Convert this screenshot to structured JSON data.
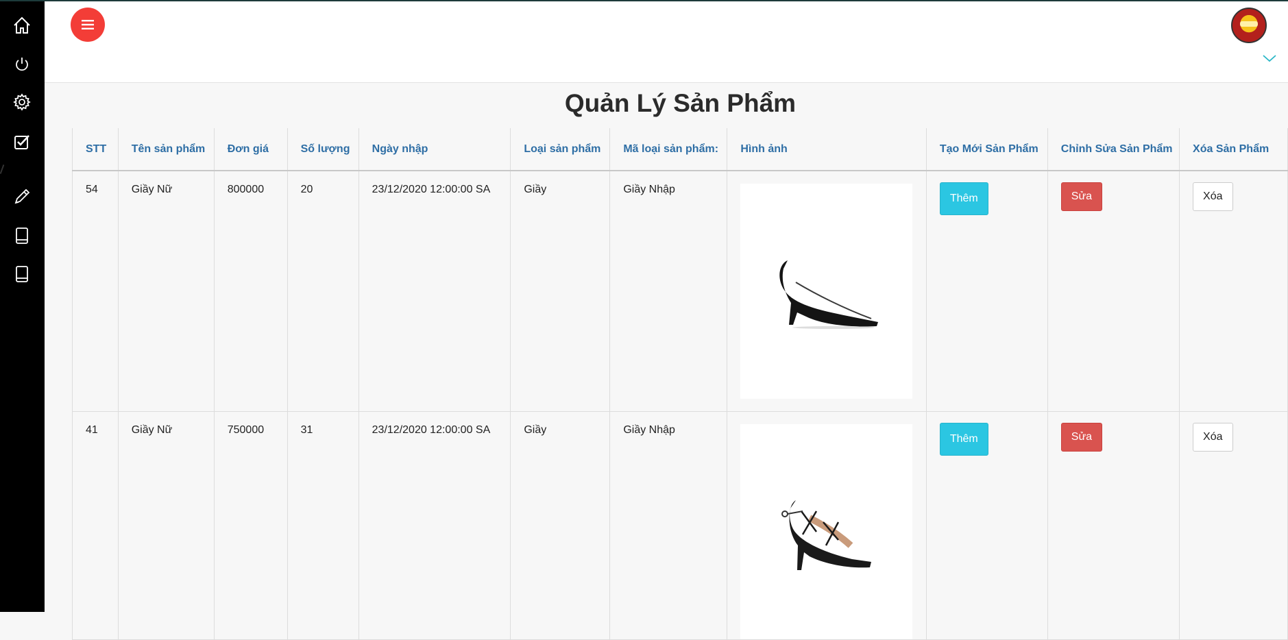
{
  "page": {
    "title": "Quản Lý Sản Phẩm"
  },
  "sidebar": {
    "items": [
      {
        "icon": "home-icon"
      },
      {
        "icon": "power-icon"
      },
      {
        "icon": "gear-icon"
      },
      {
        "icon": "checkbox-icon"
      },
      {
        "icon": "pencil-icon"
      },
      {
        "icon": "book-icon"
      },
      {
        "icon": "book-icon"
      }
    ]
  },
  "colors": {
    "sidebar": "#000000",
    "menu_button": "#f33d37",
    "header_text": "#2e6ea5",
    "add_button": "#2bc6e2",
    "edit_button": "#d9534f"
  },
  "table": {
    "headers": [
      "STT",
      "Tên sản phẩm",
      "Đơn giá",
      "Số lượng",
      "Ngày nhập",
      "Loại sản phẩm",
      "Mã loại sản phẩm:",
      "Hình ảnh",
      "Tạo Mới Sản Phẩm",
      "Chỉnh Sửa Sản Phẩm",
      "Xóa Sản Phẩm"
    ],
    "rows": [
      {
        "stt": "54",
        "name": "Giầy Nữ",
        "price": "800000",
        "qty": "20",
        "date": "23/12/2020 12:00:00 SA",
        "type": "Giầy",
        "type_code": "Giầy Nhập",
        "image": "black-pump-shoe",
        "add_label": "Thêm",
        "edit_label": "Sửa",
        "delete_label": "Xóa"
      },
      {
        "stt": "41",
        "name": "Giầy Nữ",
        "price": "750000",
        "qty": "31",
        "date": "23/12/2020 12:00:00 SA",
        "type": "Giầy",
        "type_code": "Giầy Nhập",
        "image": "black-lace-up-sandal",
        "add_label": "Thêm",
        "edit_label": "Sửa",
        "delete_label": "Xóa"
      }
    ]
  }
}
